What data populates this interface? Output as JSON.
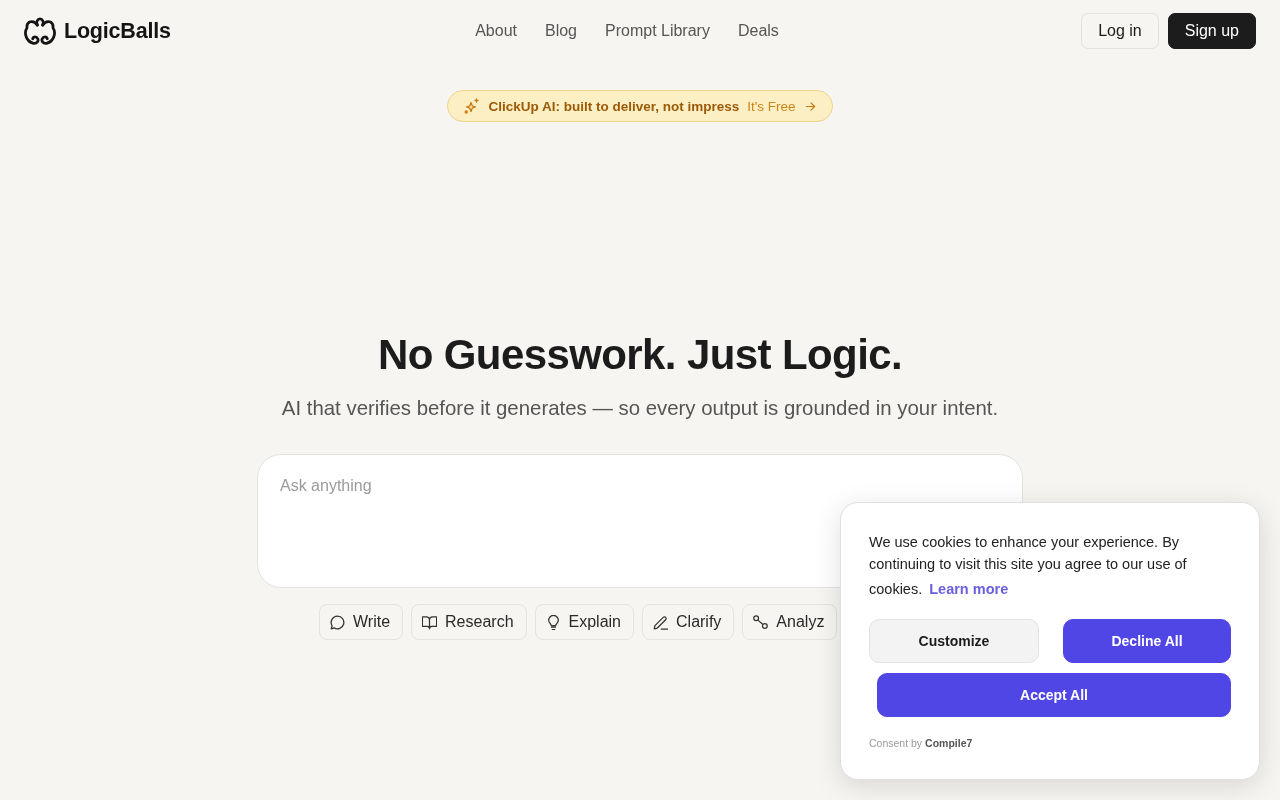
{
  "header": {
    "logo": "LogicBalls",
    "nav": [
      "About",
      "Blog",
      "Prompt Library",
      "Deals"
    ],
    "buttons": [
      {
        "label": "Log in",
        "kind": "outline"
      },
      {
        "label": "Sign up",
        "kind": "solid"
      }
    ]
  },
  "banner": {
    "text": "ClickUp AI: built to deliver, not impress",
    "link": "It's Free"
  },
  "hero": {
    "title": "No Guesswork. Just Logic.",
    "subtitle": "AI that verifies before it generates — so every output is grounded in your intent."
  },
  "prompt": {
    "placeholder": "Ask anything"
  },
  "actions": [
    {
      "label": "Write"
    },
    {
      "label": "Research"
    },
    {
      "label": "Explain"
    },
    {
      "label": "Clarify"
    },
    {
      "label": "Analyz"
    }
  ],
  "cookie_banner": {
    "message": "We use cookies to enhance your experience. By continuing to visit this site you agree to our use of cookies.",
    "link": "Learn more",
    "buttons": [
      {
        "label": "Customize",
        "kind": "secondary"
      },
      {
        "label": "Decline All",
        "kind": "primary"
      },
      {
        "label": "Accept All",
        "kind": "primary"
      }
    ],
    "footer": "Consent by **Compile7**"
  }
}
